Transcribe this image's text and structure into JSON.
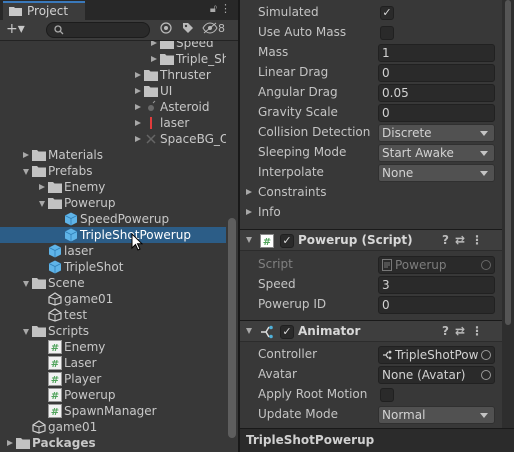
{
  "project_panel": {
    "tab_label": "Project",
    "hidden_count": "8",
    "search": {
      "value": "",
      "placeholder": ""
    },
    "tree": [
      {
        "label": "Speed",
        "type": "folder",
        "depth": 9,
        "arrow": "right"
      },
      {
        "label": "Triple_Sho",
        "type": "folder",
        "depth": 9,
        "arrow": "right"
      },
      {
        "label": "Thruster",
        "type": "folder",
        "depth": 8,
        "arrow": "right"
      },
      {
        "label": "UI",
        "type": "folder",
        "depth": 8,
        "arrow": "right"
      },
      {
        "label": "Asteroid",
        "type": "sprite-asteroid",
        "depth": 8,
        "arrow": "right"
      },
      {
        "label": "laser",
        "type": "sprite-laser",
        "depth": 8,
        "arrow": "right"
      },
      {
        "label": "SpaceBG_Ov",
        "type": "sprite-bg",
        "depth": 8,
        "arrow": "right"
      },
      {
        "label": "Materials",
        "type": "folder",
        "depth": 1,
        "arrow": "right"
      },
      {
        "label": "Prefabs",
        "type": "folder",
        "depth": 1,
        "arrow": "down"
      },
      {
        "label": "Enemy",
        "type": "folder",
        "depth": 2,
        "arrow": "right"
      },
      {
        "label": "Powerup",
        "type": "folder",
        "depth": 2,
        "arrow": "down"
      },
      {
        "label": "SpeedPowerup",
        "type": "prefab",
        "depth": 3,
        "arrow": ""
      },
      {
        "label": "TripleShotPowerup",
        "type": "prefab",
        "depth": 3,
        "arrow": "",
        "selected": true
      },
      {
        "label": "laser",
        "type": "prefab",
        "depth": 2,
        "arrow": ""
      },
      {
        "label": "TripleShot",
        "type": "prefab",
        "depth": 2,
        "arrow": ""
      },
      {
        "label": "Scene",
        "type": "folder",
        "depth": 1,
        "arrow": "down"
      },
      {
        "label": "game01",
        "type": "scene",
        "depth": 2,
        "arrow": ""
      },
      {
        "label": "test",
        "type": "scene",
        "depth": 2,
        "arrow": ""
      },
      {
        "label": "Scripts",
        "type": "folder",
        "depth": 1,
        "arrow": "down"
      },
      {
        "label": "Enemy",
        "type": "script",
        "depth": 2,
        "arrow": ""
      },
      {
        "label": "Laser",
        "type": "script",
        "depth": 2,
        "arrow": ""
      },
      {
        "label": "Player",
        "type": "script",
        "depth": 2,
        "arrow": ""
      },
      {
        "label": "Powerup",
        "type": "script",
        "depth": 2,
        "arrow": ""
      },
      {
        "label": "SpawnManager",
        "type": "script",
        "depth": 2,
        "arrow": ""
      },
      {
        "label": "game01",
        "type": "scene",
        "depth": 1,
        "arrow": ""
      },
      {
        "label": "Packages",
        "type": "folder",
        "depth": 0,
        "arrow": "right",
        "bold": true
      }
    ]
  },
  "inspector": {
    "rigidbody": {
      "simulated": {
        "label": "Simulated",
        "checked": true
      },
      "use_auto_mass": {
        "label": "Use Auto Mass",
        "checked": false
      },
      "mass": {
        "label": "Mass",
        "value": "1"
      },
      "linear_drag": {
        "label": "Linear Drag",
        "value": "0"
      },
      "angular_drag": {
        "label": "Angular Drag",
        "value": "0.05"
      },
      "gravity_scale": {
        "label": "Gravity Scale",
        "value": "0"
      },
      "collision_detection": {
        "label": "Collision Detection",
        "value": "Discrete"
      },
      "sleeping_mode": {
        "label": "Sleeping Mode",
        "value": "Start Awake"
      },
      "interpolate": {
        "label": "Interpolate",
        "value": "None"
      },
      "constraints": {
        "label": "Constraints"
      },
      "info": {
        "label": "Info"
      }
    },
    "powerup_script": {
      "title": "Powerup (Script)",
      "script": {
        "label": "Script",
        "value": "Powerup"
      },
      "speed": {
        "label": "Speed",
        "value": "3"
      },
      "powerup_id": {
        "label": "Powerup ID",
        "value": "0"
      }
    },
    "animator": {
      "title": "Animator",
      "controller": {
        "label": "Controller",
        "value": "TripleShotPow"
      },
      "avatar": {
        "label": "Avatar",
        "value": "None (Avatar)"
      },
      "apply_root_motion": {
        "label": "Apply Root Motion",
        "checked": false
      },
      "update_mode": {
        "label": "Update Mode",
        "value": "Normal"
      }
    },
    "preview_title": "TripleShotPowerup"
  },
  "colors": {
    "selection": "#2c5d87",
    "tab_accent": "#3a79bb",
    "prefab": "#5fb4e8",
    "script": "#4fa35a"
  }
}
